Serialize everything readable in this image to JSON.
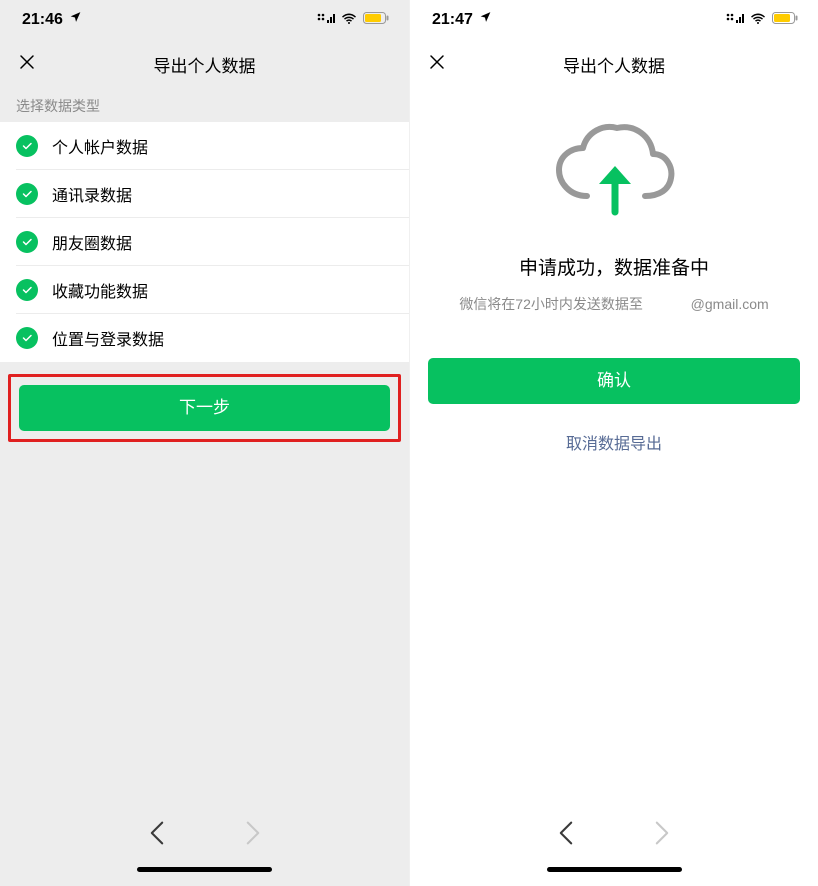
{
  "left": {
    "status": {
      "time": "21:46"
    },
    "nav": {
      "title": "导出个人数据"
    },
    "section_header": "选择数据类型",
    "items": [
      {
        "label": "个人帐户数据"
      },
      {
        "label": "通讯录数据"
      },
      {
        "label": "朋友圈数据"
      },
      {
        "label": "收藏功能数据"
      },
      {
        "label": "位置与登录数据"
      }
    ],
    "next_button": "下一步"
  },
  "right": {
    "status": {
      "time": "21:47"
    },
    "nav": {
      "title": "导出个人数据"
    },
    "success_title": "申请成功，数据准备中",
    "success_sub_prefix": "微信将在72小时内发送数据至",
    "success_email": "@gmail.com",
    "confirm_button": "确认",
    "cancel_link": "取消数据导出"
  }
}
